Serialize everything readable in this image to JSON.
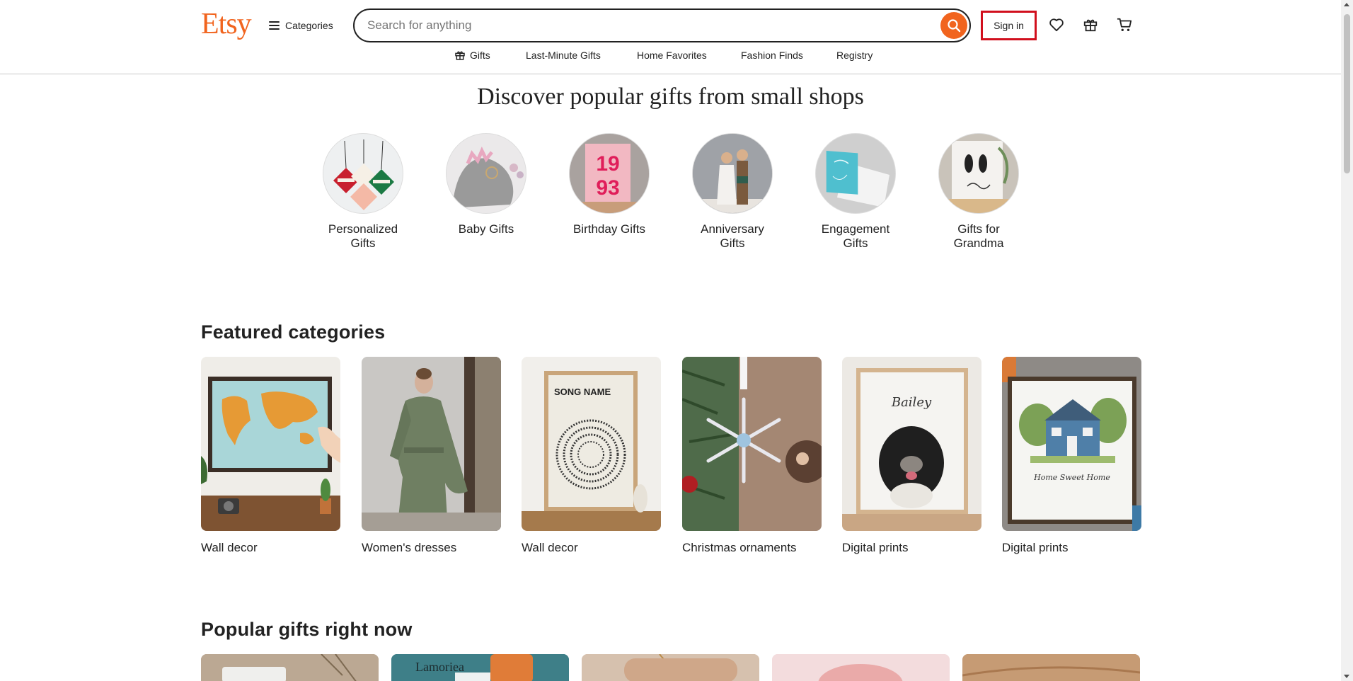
{
  "brand": {
    "logo_text": "Etsy",
    "accent_color": "#f1641e"
  },
  "header": {
    "categories_label": "Categories",
    "search_placeholder": "Search for anything",
    "signin_label": "Sign in",
    "icons": [
      "favorites-heart-icon",
      "gift-icon",
      "cart-icon"
    ]
  },
  "nav": {
    "items": [
      {
        "label": "Gifts",
        "icon": "gift-icon"
      },
      {
        "label": "Last-Minute Gifts"
      },
      {
        "label": "Home Favorites"
      },
      {
        "label": "Fashion Finds"
      },
      {
        "label": "Registry"
      }
    ]
  },
  "discover": {
    "title": "Discover popular gifts from small shops",
    "items": [
      {
        "line1": "Personalized",
        "line2": "Gifts"
      },
      {
        "line1": "Baby Gifts",
        "line2": ""
      },
      {
        "line1": "Birthday Gifts",
        "line2": ""
      },
      {
        "line1": "Anniversary",
        "line2": "Gifts"
      },
      {
        "line1": "Engagement",
        "line2": "Gifts"
      },
      {
        "line1": "Gifts for",
        "line2": "Grandma"
      }
    ],
    "birthday_image_text": {
      "top": "19",
      "bottom": "93"
    }
  },
  "featured": {
    "title": "Featured categories",
    "items": [
      {
        "label": "Wall decor"
      },
      {
        "label": "Women's dresses"
      },
      {
        "label": "Wall decor"
      },
      {
        "label": "Christmas ornaments"
      },
      {
        "label": "Digital prints"
      },
      {
        "label": "Digital prints"
      }
    ],
    "song_image_text": "SONG NAME",
    "dog_image_text": "Bailey",
    "house_image_text": "Home Sweet Home"
  },
  "popular": {
    "title": "Popular gifts right now",
    "second_card_text": "Lamoriea"
  }
}
